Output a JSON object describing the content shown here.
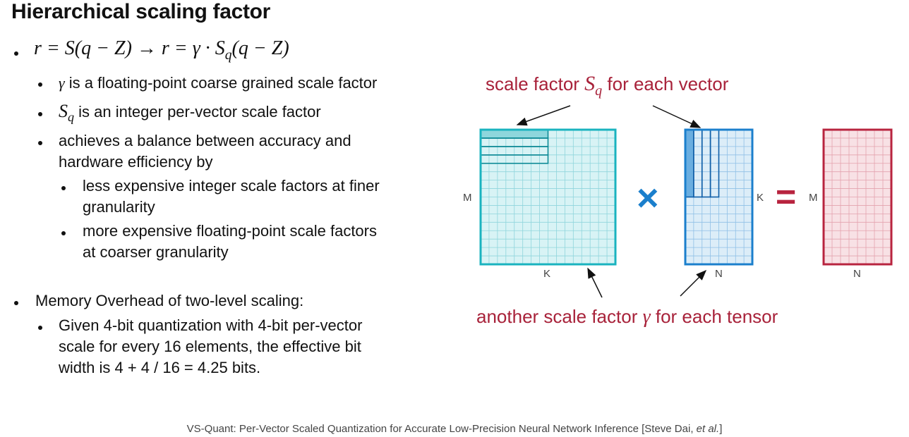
{
  "title": "Hierarchical scaling factor",
  "formula": {
    "lhs": "r = S(q − Z)",
    "arrow": "→",
    "rhs_start": "r = γ · S",
    "rhs_sub": "q",
    "rhs_end": "(q − Z)"
  },
  "bullets": {
    "gamma_sym": "γ",
    "gamma_text": " is a floating-point coarse grained scale factor",
    "sq_sym": "S",
    "sq_sub": "q",
    "sq_text": " is an integer per-vector scale factor",
    "balance_line1": "achieves a balance between accuracy and",
    "balance_line2": "hardware efficiency by",
    "less_line1": "less expensive integer scale factors at finer",
    "less_line2": "granularity",
    "more_line1": "more expensive floating-point scale factors",
    "more_line2": "at coarser granularity",
    "memory": "Memory Overhead of two-level scaling:",
    "given_line1": "Given 4-bit quantization with 4-bit per-vector",
    "given_line2": "scale for every 16 elements, the effective bit",
    "given_line3": "width is 4 + 4 / 16 = 4.25 bits."
  },
  "diagram": {
    "top_ann_pre": "scale factor ",
    "top_ann_sym": "S",
    "top_ann_sub": "q",
    "top_ann_post": " for each vector",
    "bottom_ann_pre": "another scale factor ",
    "bottom_ann_sym": "γ",
    "bottom_ann_post": " for each tensor",
    "m1_left": "M",
    "m1_bottom": "K",
    "m2_left": "K",
    "m2_bottom": "N",
    "m3_left": "M",
    "m3_bottom": "N",
    "times": "×",
    "equals": "=",
    "colors": {
      "teal_border": "#1ab3bf",
      "teal_fill": "#d8f3f5",
      "teal_grid": "#8fd5dc",
      "teal_hl": "#8ed6dc",
      "teal_lines": "#0e8a96",
      "blue_border": "#1b7fcc",
      "blue_fill": "#dcedf8",
      "blue_grid": "#8fc0e6",
      "blue_hl": "#6aaee0",
      "blue_lines": "#0f5fa8",
      "red_border": "#b8243f",
      "red_fill": "#f8e1e5",
      "red_grid": "#e3a2ae",
      "operator_blue": "#1b7fcc",
      "operator_red": "#b8243f",
      "annotation_red": "#a8223a"
    }
  },
  "footer_main": "VS-Quant: Per-Vector Scaled Quantization for Accurate Low-Precision Neural Network Inference [Steve Dai, ",
  "footer_italic": "et al.",
  "footer_end": "]"
}
